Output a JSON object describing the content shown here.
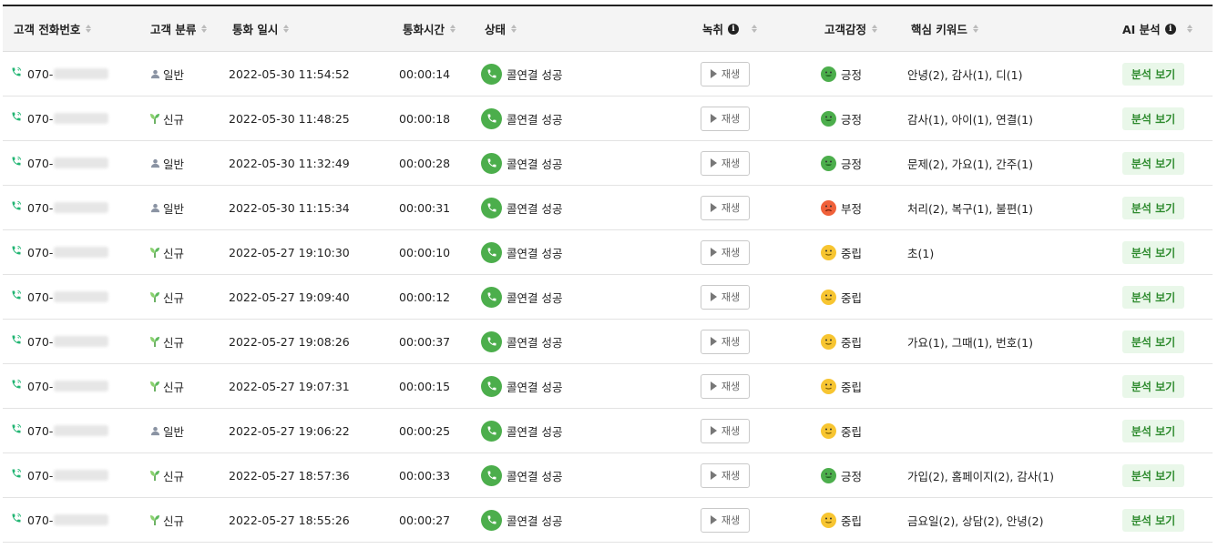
{
  "headers": {
    "phone": "고객 전화번호",
    "type": "고객 분류",
    "datetime": "통화 일시",
    "duration": "통화시간",
    "status": "상태",
    "record": "녹취",
    "emotion": "고객감정",
    "keywords": "핵심 키워드",
    "ai": "AI 분석"
  },
  "play_label": "재생",
  "ai_label": "분석 보기",
  "colors": {
    "positive": "#4cae4c",
    "negative": "#f0613a",
    "neutral": "#f7c531",
    "phone_icon": "#22b573",
    "status_bg": "#4cae4c"
  },
  "rows": [
    {
      "phone_prefix": "070-",
      "type": "일반",
      "type_kind": "general",
      "datetime": "2022-05-30 11:54:52",
      "duration": "00:00:14",
      "status": "콜연결 성공",
      "emotion": "긍정",
      "emotion_kind": "positive",
      "keywords": "안녕(2), 감사(1), 디(1)"
    },
    {
      "phone_prefix": "070-",
      "type": "신규",
      "type_kind": "new",
      "datetime": "2022-05-30 11:48:25",
      "duration": "00:00:18",
      "status": "콜연결 성공",
      "emotion": "긍정",
      "emotion_kind": "positive",
      "keywords": "감사(1), 아이(1), 연결(1)"
    },
    {
      "phone_prefix": "070-",
      "type": "일반",
      "type_kind": "general",
      "datetime": "2022-05-30 11:32:49",
      "duration": "00:00:28",
      "status": "콜연결 성공",
      "emotion": "긍정",
      "emotion_kind": "positive",
      "keywords": "문제(2), 가요(1), 간주(1)"
    },
    {
      "phone_prefix": "070-",
      "type": "일반",
      "type_kind": "general",
      "datetime": "2022-05-30 11:15:34",
      "duration": "00:00:31",
      "status": "콜연결 성공",
      "emotion": "부정",
      "emotion_kind": "negative",
      "keywords": "처리(2), 복구(1), 불편(1)"
    },
    {
      "phone_prefix": "070-",
      "type": "신규",
      "type_kind": "new",
      "datetime": "2022-05-27 19:10:30",
      "duration": "00:00:10",
      "status": "콜연결 성공",
      "emotion": "중립",
      "emotion_kind": "neutral",
      "keywords": "초(1)"
    },
    {
      "phone_prefix": "070-",
      "type": "신규",
      "type_kind": "new",
      "datetime": "2022-05-27 19:09:40",
      "duration": "00:00:12",
      "status": "콜연결 성공",
      "emotion": "중립",
      "emotion_kind": "neutral",
      "keywords": ""
    },
    {
      "phone_prefix": "070-",
      "type": "신규",
      "type_kind": "new",
      "datetime": "2022-05-27 19:08:26",
      "duration": "00:00:37",
      "status": "콜연결 성공",
      "emotion": "중립",
      "emotion_kind": "neutral",
      "keywords": "가요(1), 그때(1), 번호(1)"
    },
    {
      "phone_prefix": "070-",
      "type": "신규",
      "type_kind": "new",
      "datetime": "2022-05-27 19:07:31",
      "duration": "00:00:15",
      "status": "콜연결 성공",
      "emotion": "중립",
      "emotion_kind": "neutral",
      "keywords": ""
    },
    {
      "phone_prefix": "070-",
      "type": "일반",
      "type_kind": "general",
      "datetime": "2022-05-27 19:06:22",
      "duration": "00:00:25",
      "status": "콜연결 성공",
      "emotion": "중립",
      "emotion_kind": "neutral",
      "keywords": ""
    },
    {
      "phone_prefix": "070-",
      "type": "신규",
      "type_kind": "new",
      "datetime": "2022-05-27 18:57:36",
      "duration": "00:00:33",
      "status": "콜연결 성공",
      "emotion": "긍정",
      "emotion_kind": "positive",
      "keywords": "가입(2), 홈페이지(2), 감사(1)"
    },
    {
      "phone_prefix": "070-",
      "type": "신규",
      "type_kind": "new",
      "datetime": "2022-05-27 18:55:26",
      "duration": "00:00:27",
      "status": "콜연결 성공",
      "emotion": "중립",
      "emotion_kind": "neutral",
      "keywords": "금요일(2), 상담(2), 안녕(2)"
    }
  ]
}
